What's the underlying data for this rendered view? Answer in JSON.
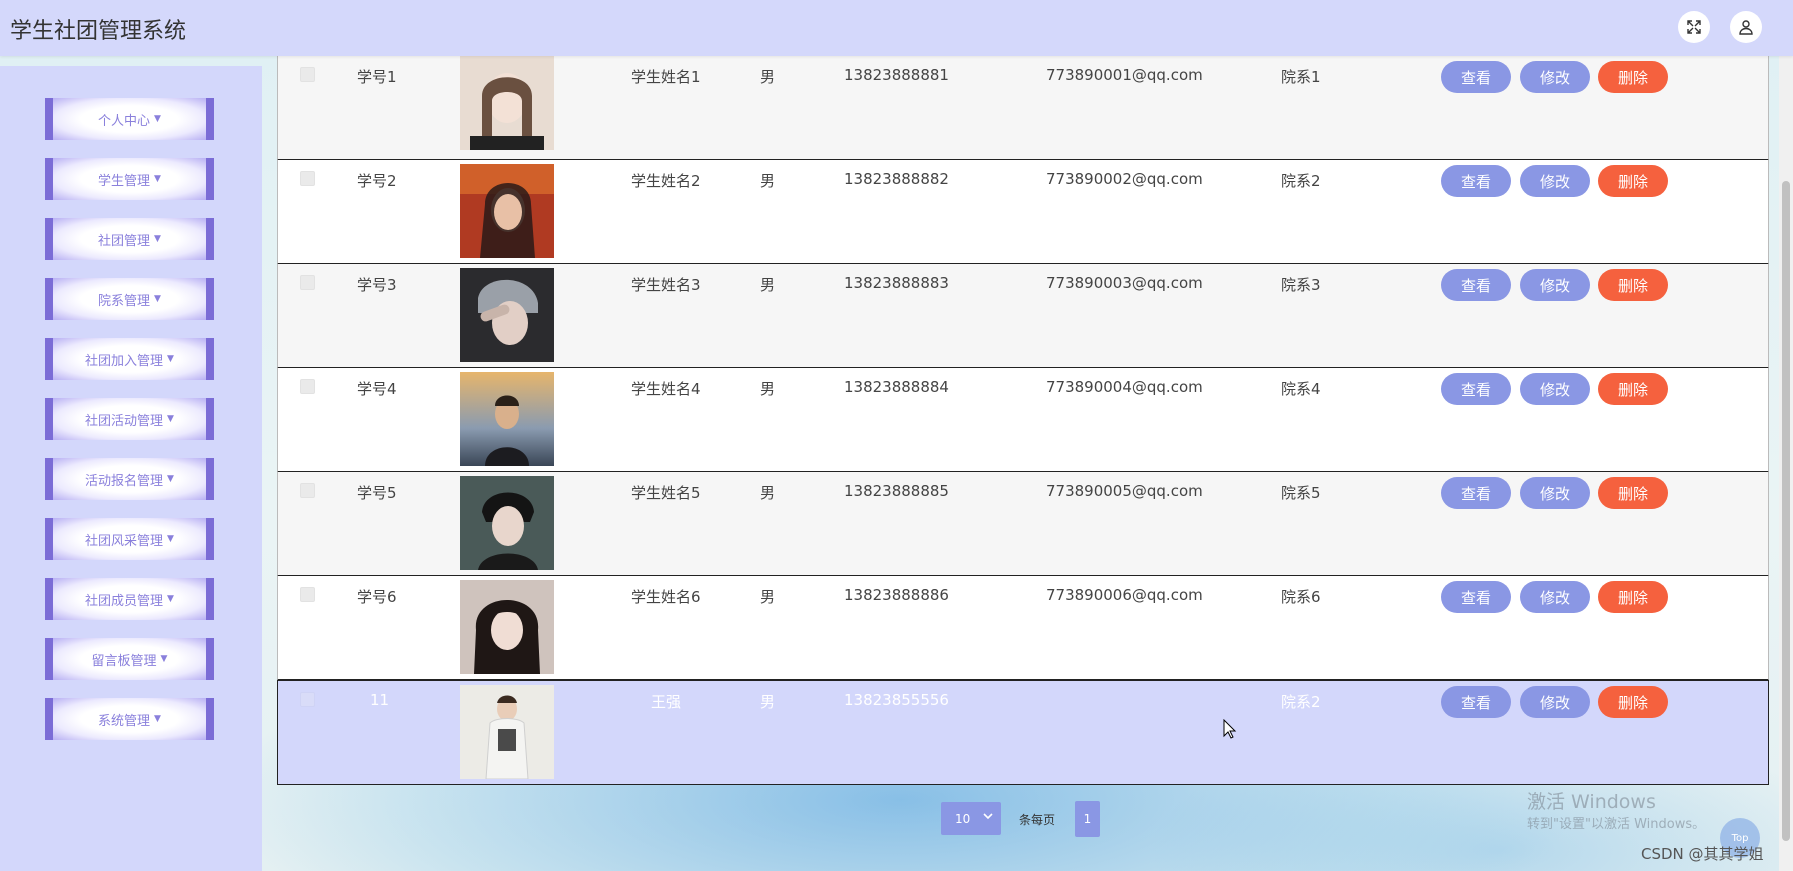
{
  "header": {
    "title": "学生社团管理系统",
    "fullscreen_icon": "expand-icon",
    "user_icon": "user-icon"
  },
  "sidebar": {
    "items": [
      {
        "label": "个人中心"
      },
      {
        "label": "学生管理"
      },
      {
        "label": "社团管理"
      },
      {
        "label": "院系管理"
      },
      {
        "label": "社团加入管理"
      },
      {
        "label": "社团活动管理"
      },
      {
        "label": "活动报名管理"
      },
      {
        "label": "社团风采管理"
      },
      {
        "label": "社团成员管理"
      },
      {
        "label": "留言板管理"
      },
      {
        "label": "系统管理"
      }
    ]
  },
  "table": {
    "rows": [
      {
        "id": "学号1",
        "name": "学生姓名1",
        "gender": "男",
        "phone": "13823888881",
        "email": "773890001@qq.com",
        "dept": "院系1"
      },
      {
        "id": "学号2",
        "name": "学生姓名2",
        "gender": "男",
        "phone": "13823888882",
        "email": "773890002@qq.com",
        "dept": "院系2"
      },
      {
        "id": "学号3",
        "name": "学生姓名3",
        "gender": "男",
        "phone": "13823888883",
        "email": "773890003@qq.com",
        "dept": "院系3"
      },
      {
        "id": "学号4",
        "name": "学生姓名4",
        "gender": "男",
        "phone": "13823888884",
        "email": "773890004@qq.com",
        "dept": "院系4"
      },
      {
        "id": "学号5",
        "name": "学生姓名5",
        "gender": "男",
        "phone": "13823888885",
        "email": "773890005@qq.com",
        "dept": "院系5"
      },
      {
        "id": "学号6",
        "name": "学生姓名6",
        "gender": "男",
        "phone": "13823888886",
        "email": "773890006@qq.com",
        "dept": "院系6"
      },
      {
        "id": "11",
        "name": "王强",
        "gender": "男",
        "phone": "13823855556",
        "email": "",
        "dept": "院系2"
      }
    ],
    "actions": {
      "view": "查看",
      "edit": "修改",
      "delete": "删除"
    }
  },
  "pagination": {
    "page_size": "10",
    "page_size_label": "条每页",
    "current_page": "1"
  },
  "watermark": {
    "line1": "激活 Windows",
    "line2": "转到\"设置\"以激活 Windows。"
  },
  "footer": {
    "csdn": "CSDN @其其学姐",
    "top": "Top"
  },
  "colors": {
    "header_bg": "#d4d8fb",
    "accent": "#8a97e4",
    "danger": "#f5613e",
    "menu_border": "#7b6cd6"
  }
}
